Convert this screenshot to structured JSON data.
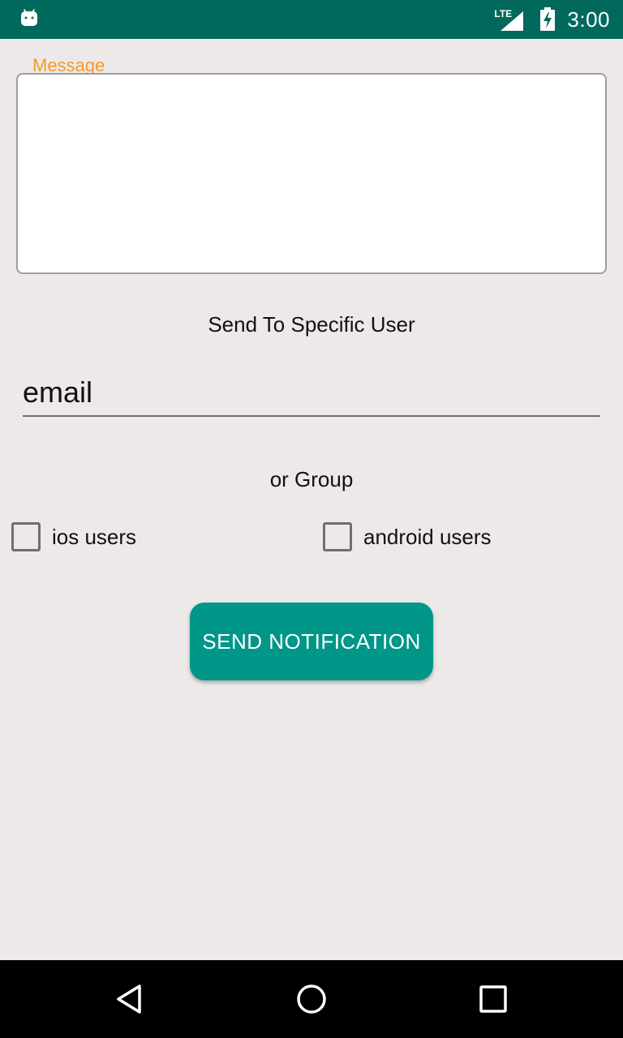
{
  "status_bar": {
    "app_icon": "android-robot-icon",
    "network_label": "LTE",
    "signal_icon": "cell-signal-icon",
    "battery_icon": "battery-charging-icon",
    "time": "3:00",
    "background_color": "#00695c"
  },
  "message_field": {
    "label": "Message",
    "value": "",
    "label_color": "#f39a2a"
  },
  "specific_user": {
    "heading": "Send To Specific User",
    "email_placeholder": "email",
    "email_value": ""
  },
  "group": {
    "heading": "or Group",
    "options": [
      {
        "label": "ios users",
        "checked": false
      },
      {
        "label": "android users",
        "checked": false
      }
    ]
  },
  "send_button": {
    "label": "SEND NOTIFICATION",
    "color": "#009688"
  },
  "nav_bar": {
    "back_icon": "back-triangle-icon",
    "home_icon": "home-circle-icon",
    "recents_icon": "recents-square-icon"
  }
}
